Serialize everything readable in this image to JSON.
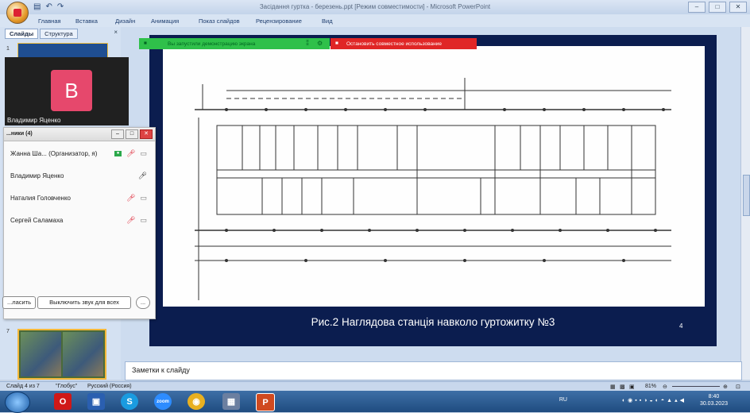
{
  "app": {
    "title": "Засідання гуртка - березень.ppt [Режим совместимости] - Microsoft PowerPoint",
    "qat_icons": [
      "save-icon",
      "undo-icon",
      "redo-icon"
    ],
    "window_controls": [
      "minimize-icon",
      "restore-icon",
      "close-icon"
    ]
  },
  "ribbon": {
    "tabs": [
      "Главная",
      "Вставка",
      "Дизайн",
      "Анимация",
      "Показ слайдов",
      "Рецензирование",
      "Вид"
    ]
  },
  "left_pane": {
    "tabs": [
      "Слайды",
      "Структура"
    ],
    "close": "×",
    "slide_numbers": [
      "1",
      "7"
    ]
  },
  "video": {
    "avatar_letter": "В",
    "name": "Владимир Яценко"
  },
  "participants": {
    "title": "...ники (4)",
    "rows": [
      {
        "name": "Жанна Ша... (Организатор, я)",
        "host_badge": true,
        "mic": "muted",
        "cam": "off"
      },
      {
        "name": "Владимир Яценко",
        "host_badge": false,
        "mic": "on",
        "cam": "none"
      },
      {
        "name": "Наталия Головченко",
        "host_badge": false,
        "mic": "muted",
        "cam": "off"
      },
      {
        "name": "Сергей Саламаха",
        "host_badge": false,
        "mic": "muted",
        "cam": "off"
      }
    ],
    "buttons": {
      "invite": "...ласить",
      "mute_all": "Выключить звук для всех",
      "more": "..."
    }
  },
  "share": {
    "green_text": "Вы запустили демонстрацию экрана",
    "red_text": "Остановить совместное использование"
  },
  "slide": {
    "caption": "Рис.2  Наглядова станція навколо гуртожитку №3",
    "number": "4"
  },
  "notes": {
    "placeholder": "Заметки к слайду"
  },
  "status": {
    "slide_info": "Слайд 4 из 7",
    "theme": "\"Глобус\"",
    "language": "Русский (Россия)",
    "zoom": "81%"
  },
  "taskbar": {
    "apps": [
      {
        "icon": "opera-icon",
        "color": "#d01818",
        "label": "O"
      },
      {
        "icon": "save-floppy-icon",
        "color": "#2a5fb0",
        "label": "▣"
      },
      {
        "icon": "skype-icon",
        "color": "#1a9be0",
        "label": "S"
      },
      {
        "icon": "zoom-icon",
        "color": "#2d8cff",
        "label": "zoom"
      },
      {
        "icon": "chrome-icon",
        "color": "#e8b020",
        "label": "◉"
      },
      {
        "icon": "file-manager-icon",
        "color": "#6b7fa0",
        "label": "▦"
      },
      {
        "icon": "powerpoint-icon",
        "color": "#d04a20",
        "label": "P"
      }
    ],
    "language": "RU",
    "time": "8:40",
    "date": "30.03.2023"
  }
}
